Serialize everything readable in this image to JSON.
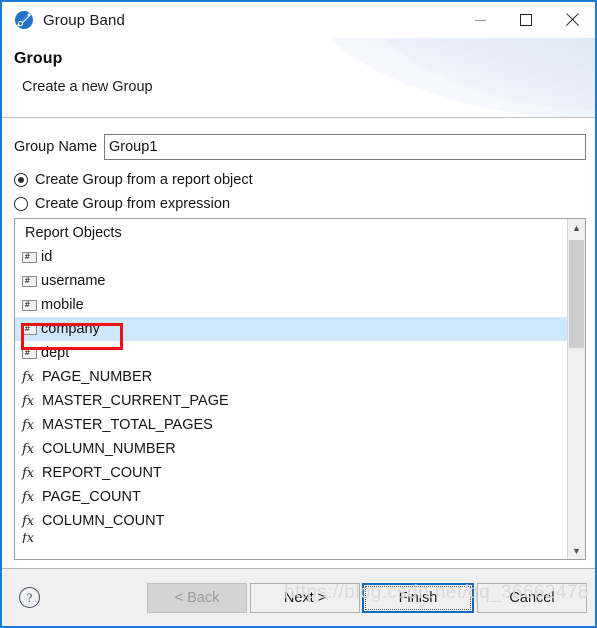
{
  "window": {
    "title": "Group Band",
    "icon": "group-band-icon",
    "accent_color": "#1a7bd4",
    "caption": {
      "minimize": "minimize-icon",
      "maximize": "maximize-icon",
      "close": "close-icon"
    }
  },
  "header": {
    "title": "Group",
    "subtitle": "Create a new Group"
  },
  "form": {
    "group_name_label": "Group Name",
    "group_name_value": "Group1",
    "group_name_placeholder": "",
    "radios": [
      {
        "label": "Create Group from a report object",
        "selected": true
      },
      {
        "label": "Create Group from expression",
        "selected": false
      }
    ]
  },
  "list": {
    "header": "Report Objects",
    "selected_color": "#cfe7fb",
    "annotation_color": "#ee1111",
    "items": [
      {
        "label": "id",
        "icon": "field-icon"
      },
      {
        "label": "username",
        "icon": "field-icon"
      },
      {
        "label": "mobile",
        "icon": "field-icon"
      },
      {
        "label": "company",
        "icon": "field-icon"
      },
      {
        "label": "dept",
        "icon": "field-icon"
      },
      {
        "label": "PAGE_NUMBER",
        "icon": "function-icon"
      },
      {
        "label": "MASTER_CURRENT_PAGE",
        "icon": "function-icon"
      },
      {
        "label": "MASTER_TOTAL_PAGES",
        "icon": "function-icon"
      },
      {
        "label": "COLUMN_NUMBER",
        "icon": "function-icon"
      },
      {
        "label": "REPORT_COUNT",
        "icon": "function-icon"
      },
      {
        "label": "PAGE_COUNT",
        "icon": "function-icon"
      },
      {
        "label": "COLUMN_COUNT",
        "icon": "function-icon"
      }
    ],
    "selected_index": 3,
    "function_icon_glyph": "fx",
    "field_icon_glyph": "#",
    "scrollbar": {
      "up_arrow": "chevron-up-icon",
      "down_arrow": "chevron-down-icon"
    }
  },
  "footer": {
    "help": "?",
    "buttons": [
      {
        "label": "< Back",
        "enabled": false
      },
      {
        "label": "Next >",
        "enabled": true
      },
      {
        "label": "Finish",
        "enabled": true,
        "focused": true
      },
      {
        "label": "Cancel",
        "enabled": true
      }
    ]
  },
  "watermark": "https://blog.csdn.net/qq_36662478"
}
